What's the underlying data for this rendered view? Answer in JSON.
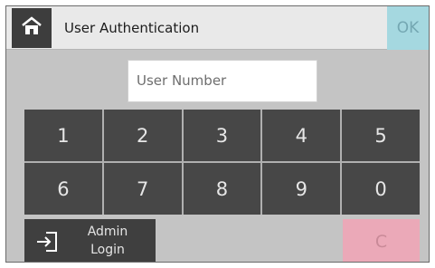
{
  "header": {
    "title": "User Authentication",
    "ok_label": "OK",
    "home_icon": "home-icon"
  },
  "login": {
    "user_number_placeholder": "User Number",
    "user_number_value": ""
  },
  "keypad": {
    "keys": [
      "1",
      "2",
      "3",
      "4",
      "5",
      "6",
      "7",
      "8",
      "9",
      "0"
    ]
  },
  "footer": {
    "admin_label": "Admin\nLogin",
    "admin_icon": "login-icon",
    "clear_label": "C"
  },
  "colors": {
    "ok_button": "#a5d8e0",
    "clear_button": "#eba9b8",
    "key_bg": "#474747"
  }
}
